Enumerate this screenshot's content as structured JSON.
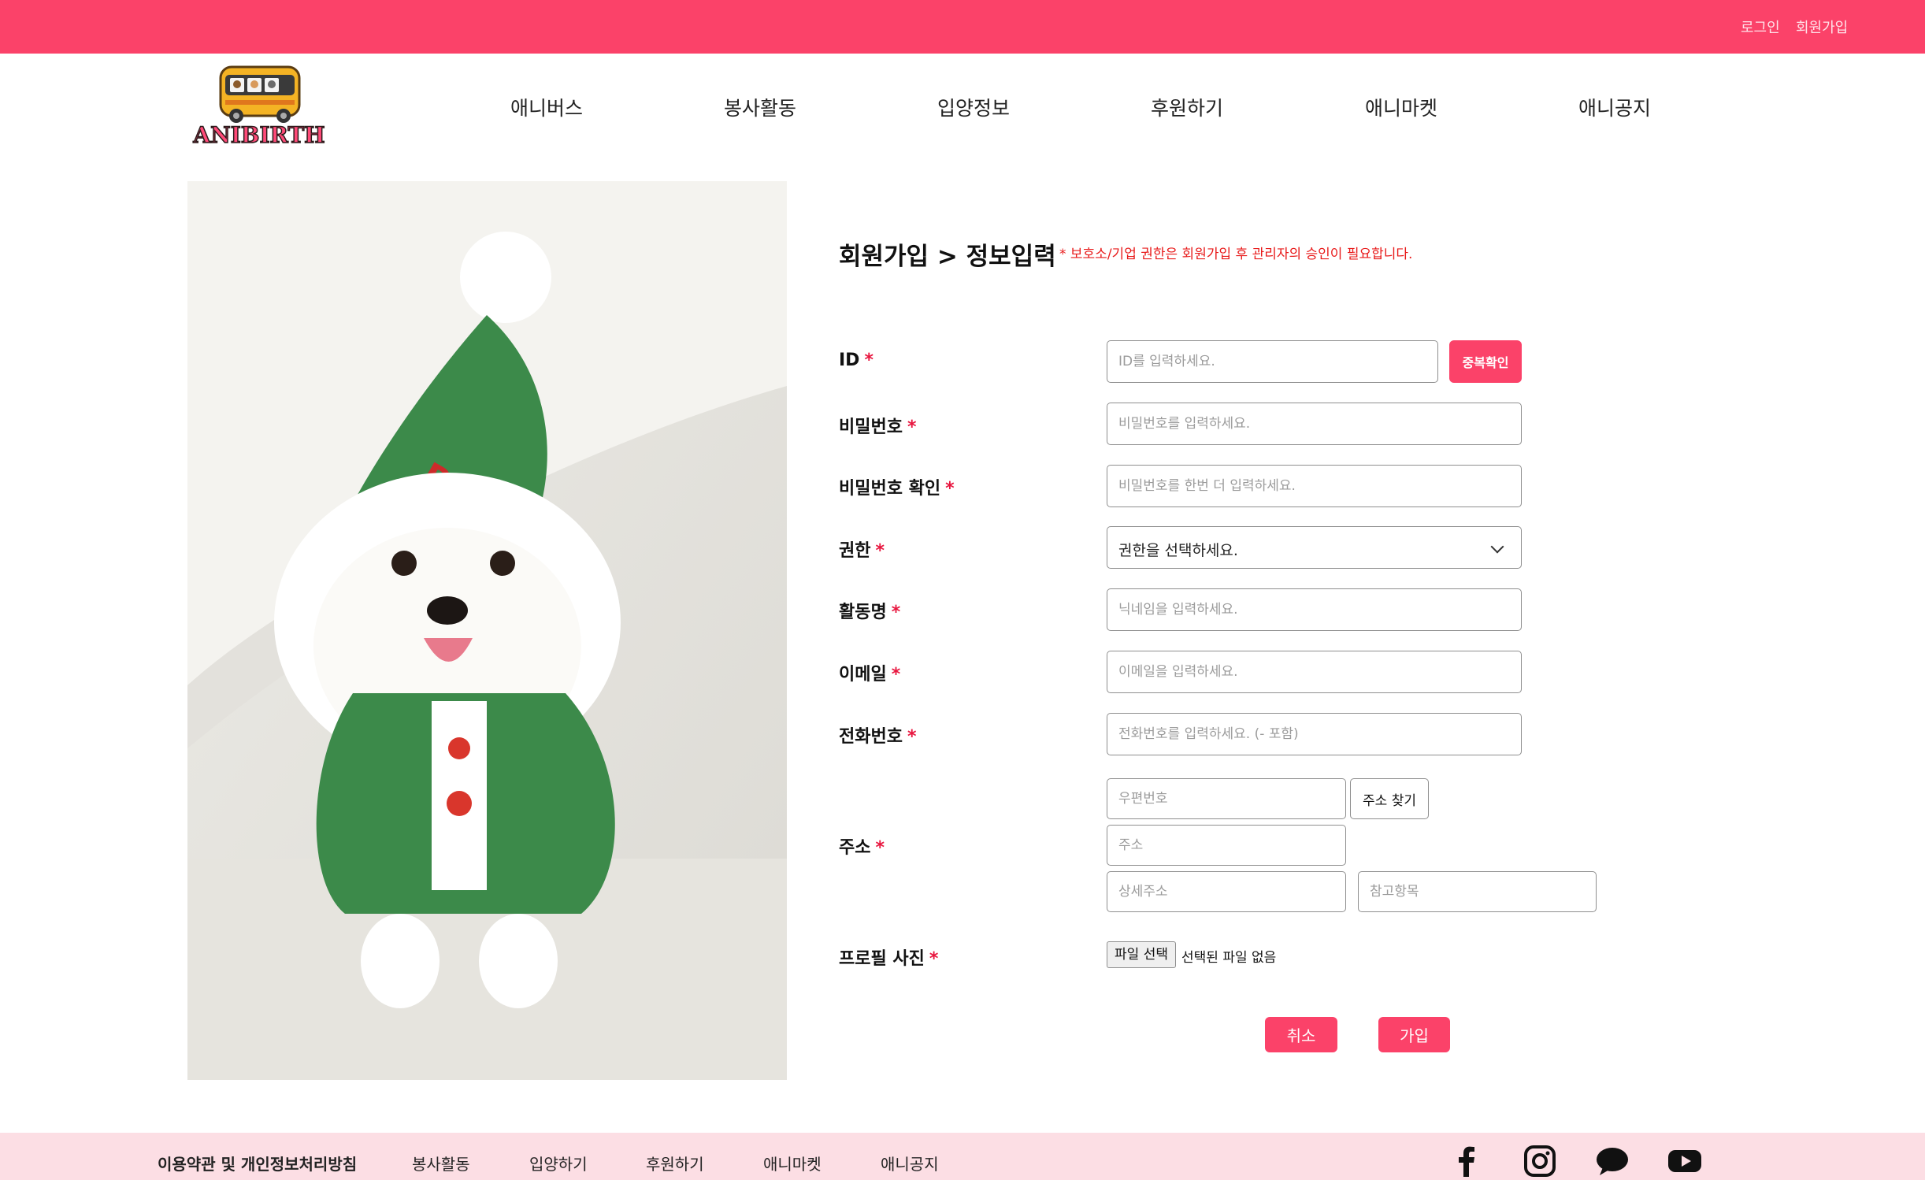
{
  "topbar": {
    "login": "로그인",
    "signup": "회원가입"
  },
  "logo": {
    "text": "ANIBIRTH"
  },
  "nav": [
    "애니버스",
    "봉사활동",
    "입양정보",
    "후원하기",
    "애니마켓",
    "애니공지"
  ],
  "form": {
    "title": "회원가입 > 정보입력",
    "notice": "* 보호소/기업 권한은 회원가입 후 관리자의 승인이 필요합니다.",
    "required_mark": "*",
    "labels": {
      "id": "ID",
      "password": "비밀번호",
      "password_confirm": "비밀번호 확인",
      "role": "권한",
      "nickname": "활동명",
      "email": "이메일",
      "phone": "전화번호",
      "address": "주소",
      "profile": "프로필 사진"
    },
    "placeholders": {
      "id": "ID를 입력하세요.",
      "password": "비밀번호를 입력하세요.",
      "password_confirm": "비밀번호를 한번 더 입력하세요.",
      "nickname": "닉네임을 입력하세요.",
      "email": "이메일을 입력하세요.",
      "phone": "전화번호를 입력하세요. (- 포함)",
      "postcode": "우편번호",
      "address": "주소",
      "address_detail": "상세주소",
      "address_extra": "참고항목"
    },
    "role_selected": "권한을 선택하세요.",
    "dup_check_button": "중복확인",
    "find_address_button": "주소 찾기",
    "file_button": "파일 선택",
    "file_status": "선택된 파일 없음",
    "cancel_button": "취소",
    "submit_button": "가입"
  },
  "footer": {
    "links": [
      "이용약관 및 개인정보처리방침",
      "봉사활동",
      "입양하기",
      "후원하기",
      "애니마켓",
      "애니공지"
    ],
    "social": [
      "facebook-icon",
      "instagram-icon",
      "kakao-talk-icon",
      "youtube-icon"
    ]
  },
  "colors": {
    "brand": "#fb4269",
    "footer_bg": "#fcdee4",
    "notice": "#e81a1a"
  }
}
